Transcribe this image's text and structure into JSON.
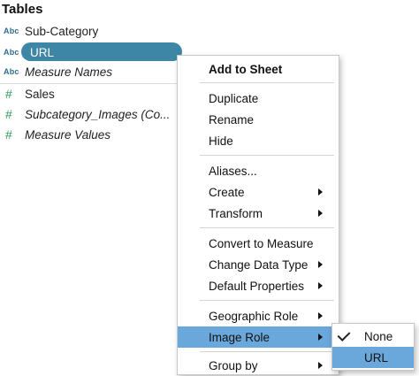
{
  "panel": {
    "title": "Tables",
    "fields": [
      {
        "type_label": "Abc",
        "name": "Sub-Category"
      },
      {
        "type_label": "Abc",
        "name": "URL"
      },
      {
        "type_label": "Abc",
        "name": "Measure Names"
      },
      {
        "type_label": "#",
        "name": "Sales"
      },
      {
        "type_label": "#",
        "name": "Subcategory_Images (Co..."
      },
      {
        "type_label": "#",
        "name": "Measure Values"
      }
    ]
  },
  "context_menu": {
    "items": [
      {
        "label": "Add to Sheet"
      },
      {
        "label": "Duplicate"
      },
      {
        "label": "Rename"
      },
      {
        "label": "Hide"
      },
      {
        "label": "Aliases..."
      },
      {
        "label": "Create"
      },
      {
        "label": "Transform"
      },
      {
        "label": "Convert to Measure"
      },
      {
        "label": "Change Data Type"
      },
      {
        "label": "Default Properties"
      },
      {
        "label": "Geographic Role"
      },
      {
        "label": "Image Role"
      },
      {
        "label": "Group by"
      }
    ]
  },
  "image_role_submenu": {
    "items": [
      {
        "label": "None",
        "checked": true
      },
      {
        "label": "URL"
      }
    ]
  },
  "colors": {
    "selected_pill": "#3d86a6",
    "menu_highlight": "#6aa8dc",
    "dimension_icon": "#2f6c8f",
    "measure_icon": "#2e9a5c"
  }
}
